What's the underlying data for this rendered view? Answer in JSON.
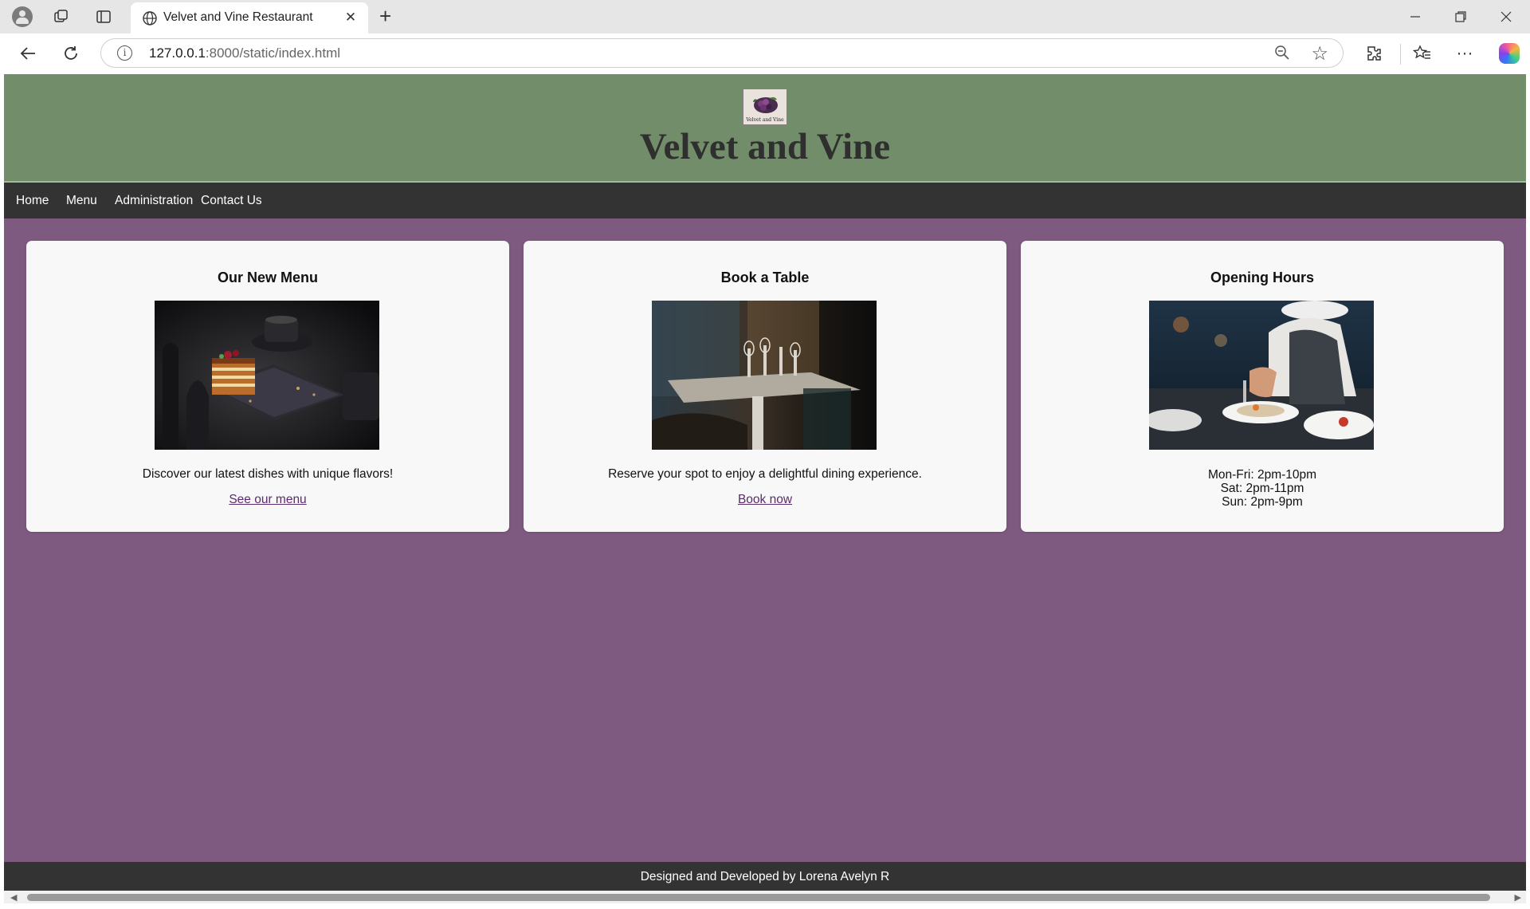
{
  "browser": {
    "tab_title": "Velvet and Vine Restaurant",
    "url_host": "127.0.0.1",
    "url_path": ":8000/static/index.html",
    "icons": [
      "profile-icon",
      "workspaces-icon",
      "tab-actions-icon",
      "globe-icon",
      "close-icon",
      "new-tab-icon",
      "minimize-icon",
      "restore-icon",
      "window-close-icon",
      "back-icon",
      "refresh-icon",
      "info-icon",
      "zoom-out-icon",
      "favorite-star-icon",
      "extensions-icon",
      "favorites-icon",
      "more-icon",
      "copilot-icon"
    ]
  },
  "site": {
    "logo_text": "Velvet and Vine",
    "title": "Velvet and Vine",
    "nav": [
      "Home",
      "Menu",
      "Administration",
      "Contact Us"
    ],
    "cards": [
      {
        "title": "Our New Menu",
        "text": "Discover our latest dishes with unique flavors!",
        "link": "See our menu"
      },
      {
        "title": "Book a Table",
        "text": "Reserve your spot to enjoy a delightful dining experience.",
        "link": "Book now"
      },
      {
        "title": "Opening Hours",
        "hours": [
          "Mon-Fri: 2pm-10pm",
          "Sat: 2pm-11pm",
          "Sun: 2pm-9pm"
        ]
      }
    ],
    "footer": "Designed and Developed by Lorena Avelyn R"
  },
  "colors": {
    "header_green": "#728d69",
    "body_purple": "#7e5a80",
    "nav_dark": "#333333",
    "card_bg": "#f8f8f8",
    "link_purple": "#5b2b6e"
  }
}
